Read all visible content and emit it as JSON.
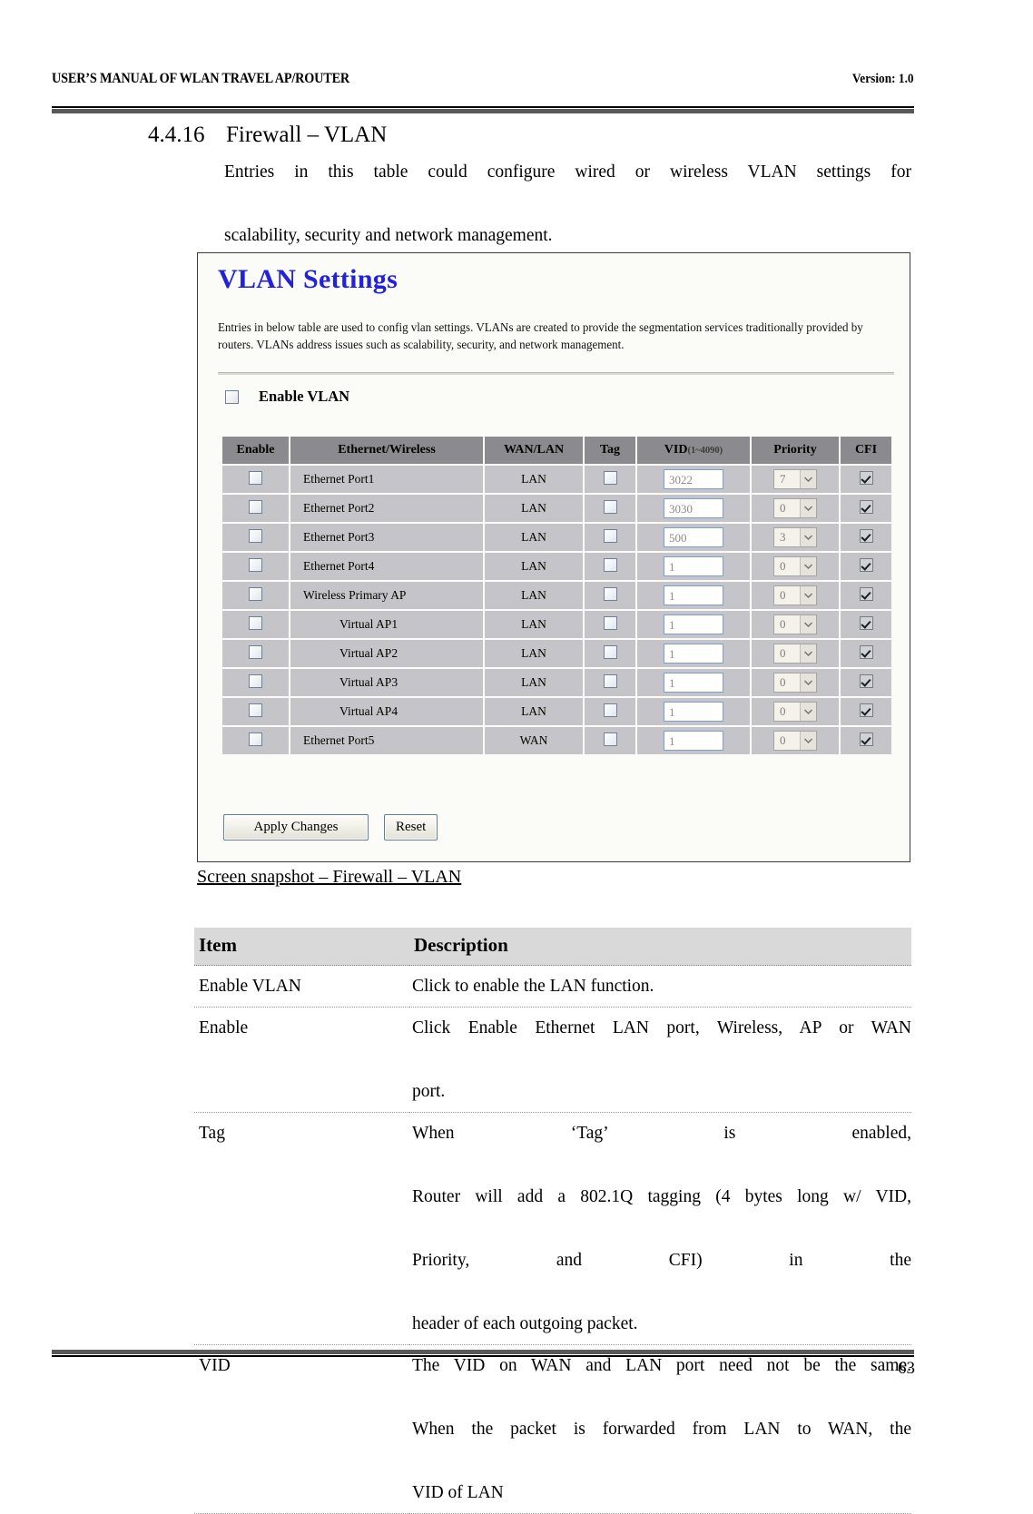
{
  "header": {
    "left": "USER’S MANUAL OF WLAN TRAVEL AP/ROUTER",
    "right": "Version: 1.0"
  },
  "footer": {
    "page_number": "63"
  },
  "section": {
    "number": "4.4.16",
    "title": "Firewall – VLAN",
    "intro_line1": "Entries in this table could configure wired or wireless VLAN settings for",
    "intro_line2": "scalability, security and network management."
  },
  "screenshot": {
    "title": "VLAN Settings",
    "description_line1": "Entries in below table are used to config vlan settings. VLANs are created to provide the segmentation services",
    "description_line2": "traditionally provided by routers. VLANs address issues such as scalability, security, and network management.",
    "enable_vlan": {
      "label": "Enable VLAN",
      "checked": false
    },
    "table": {
      "headers": {
        "enable": "Enable",
        "ethernet_wireless": "Ethernet/Wireless",
        "wan_lan": "WAN/LAN",
        "tag": "Tag",
        "vid": "VID",
        "vid_range": "(1~4090)",
        "priority": "Priority",
        "cfi": "CFI"
      },
      "rows": [
        {
          "enable": false,
          "name": "Ethernet Port1",
          "indent": false,
          "wan_lan": "LAN",
          "tag": false,
          "vid": "3022",
          "priority": "7",
          "cfi": true
        },
        {
          "enable": false,
          "name": "Ethernet Port2",
          "indent": false,
          "wan_lan": "LAN",
          "tag": false,
          "vid": "3030",
          "priority": "0",
          "cfi": true
        },
        {
          "enable": false,
          "name": "Ethernet Port3",
          "indent": false,
          "wan_lan": "LAN",
          "tag": false,
          "vid": "500",
          "priority": "3",
          "cfi": true
        },
        {
          "enable": false,
          "name": "Ethernet Port4",
          "indent": false,
          "wan_lan": "LAN",
          "tag": false,
          "vid": "1",
          "priority": "0",
          "cfi": true
        },
        {
          "enable": false,
          "name": "Wireless Primary AP",
          "indent": false,
          "wan_lan": "LAN",
          "tag": false,
          "vid": "1",
          "priority": "0",
          "cfi": true
        },
        {
          "enable": false,
          "name": "Virtual AP1",
          "indent": true,
          "wan_lan": "LAN",
          "tag": false,
          "vid": "1",
          "priority": "0",
          "cfi": true
        },
        {
          "enable": false,
          "name": "Virtual AP2",
          "indent": true,
          "wan_lan": "LAN",
          "tag": false,
          "vid": "1",
          "priority": "0",
          "cfi": true
        },
        {
          "enable": false,
          "name": "Virtual AP3",
          "indent": true,
          "wan_lan": "LAN",
          "tag": false,
          "vid": "1",
          "priority": "0",
          "cfi": true
        },
        {
          "enable": false,
          "name": "Virtual AP4",
          "indent": true,
          "wan_lan": "LAN",
          "tag": false,
          "vid": "1",
          "priority": "0",
          "cfi": true
        },
        {
          "enable": false,
          "name": "Ethernet Port5",
          "indent": false,
          "wan_lan": "WAN",
          "tag": false,
          "vid": "1",
          "priority": "0",
          "cfi": true
        }
      ]
    },
    "buttons": {
      "apply": "Apply Changes",
      "reset": "Reset"
    }
  },
  "caption": "Screen snapshot – Firewall – VLAN",
  "description_table": {
    "headers": {
      "item": "Item",
      "description": "Description"
    },
    "rows": [
      {
        "item": "Enable VLAN",
        "lines": [
          "Click to enable the LAN function."
        ]
      },
      {
        "item": "Enable",
        "lines": [
          "Click Enable Ethernet LAN port, Wireless, AP or WAN",
          "port."
        ]
      },
      {
        "item": "Tag",
        "lines": [
          "When ‘Tag’ is enabled,",
          "Router will add a 802.1Q tagging (4 bytes long w/ VID,",
          "Priority, and CFI) in the",
          "header of each outgoing packet."
        ]
      },
      {
        "item": "VID",
        "lines": [
          "The VID on WAN and LAN port need not be the same.",
          "When the packet is forwarded from LAN to WAN, the",
          "VID of LAN"
        ]
      }
    ]
  },
  "colors": {
    "title_blue": "#2222dd",
    "table_header_gray": "#8b8b8f",
    "table_cell_gray": "#c5c5c9",
    "rule_gray": "#595959",
    "desc_header_gray": "#d9d9d9"
  }
}
